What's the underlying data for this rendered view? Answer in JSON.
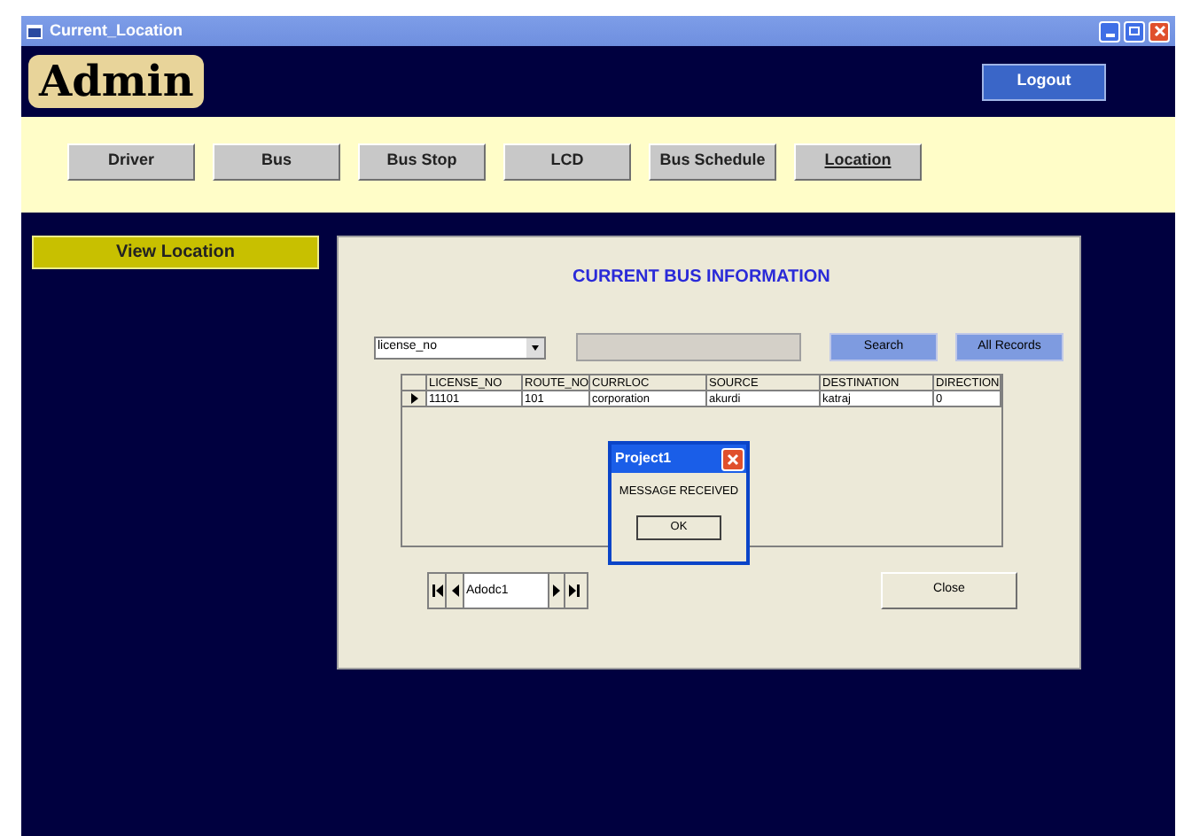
{
  "window": {
    "title": "Current_Location"
  },
  "header": {
    "logo": "Admin",
    "logout": "Logout"
  },
  "nav": [
    {
      "label": "Driver",
      "selected": false
    },
    {
      "label": "Bus",
      "selected": false
    },
    {
      "label": "Bus Stop",
      "selected": false
    },
    {
      "label": "LCD",
      "selected": false
    },
    {
      "label": "Bus Schedule",
      "selected": false
    },
    {
      "label": "Location",
      "selected": true
    }
  ],
  "sidebar": {
    "items": [
      "View Location"
    ]
  },
  "panel": {
    "title": "CURRENT BUS INFORMATION",
    "filter": "license_no",
    "search": "Search",
    "all_records": "All Records",
    "table": {
      "columns": [
        "LICENSE_NO",
        "ROUTE_NO",
        "CURRLOC",
        "SOURCE",
        "DESTINATION",
        "DIRECTION"
      ],
      "rows": [
        {
          "current": true,
          "cells": [
            "11101",
            "101",
            "corporation",
            "akurdi",
            "katraj",
            "0"
          ]
        }
      ]
    },
    "adodc": "Adodc1",
    "close": "Close"
  },
  "dialog": {
    "title": "Project1",
    "message": "MESSAGE RECEIVED",
    "ok": "OK"
  }
}
